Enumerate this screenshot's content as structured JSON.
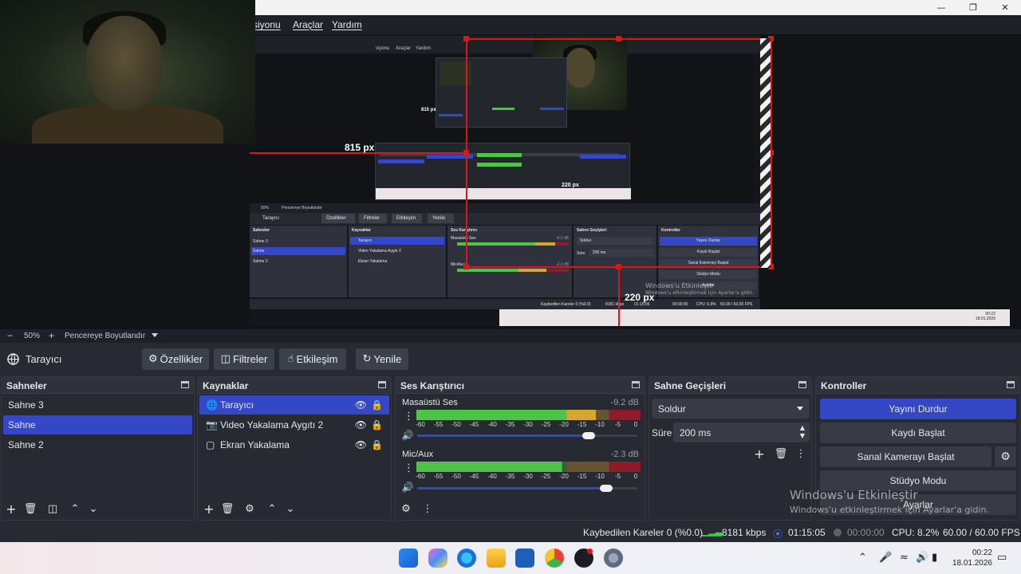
{
  "window": {
    "controls": [
      "minimize",
      "maximize",
      "close"
    ]
  },
  "menu": {
    "items": [
      "siyonu",
      "Araçlar",
      "Yardım"
    ]
  },
  "preview": {
    "label_horizontal": "815 px",
    "label_vertical": "220 px",
    "nested_labels": {
      "horizontal": "815 px",
      "vertical": "220 px"
    },
    "nested_menu": [
      "siyonu",
      "Araçlar",
      "Yardım"
    ],
    "mini_toolbar": {
      "source": "Tarayıcı",
      "buttons": [
        "Özellikler",
        "Filtreler",
        "Etkileşim",
        "Yenile"
      ]
    },
    "mini_docks": {
      "scenes_title": "Sahneler",
      "scenes": [
        "Sahne 3",
        "Sahne",
        "Sahne 2"
      ],
      "sources_title": "Kaynaklar",
      "sources": [
        "Tarayıcı",
        "Video Yakalama Aygıtı 2",
        "Ekran Yakalama"
      ],
      "mixer_title": "Ses Karıştırıcı",
      "mixer_a": "Masaüstü Ses",
      "mixer_a_db": "-9.2 dB",
      "mixer_b": "Mic/Aux",
      "mixer_b_db": "-2.3 dB",
      "trans_title": "Sahne Geçişleri",
      "trans_value": "Soldur",
      "trans_dur_label": "Süre",
      "trans_dur": "200 ms",
      "ctrl_title": "Kontroller",
      "ctrl": [
        "Yayını Durdur",
        "Kaydı Başlat",
        "Sanal Kamerayı Başlat",
        "Stüdyo Modu",
        "Ayarlar"
      ]
    },
    "mini_zoom": "50%",
    "mini_resize": "Pencereye Boyutlandır",
    "mini_status": {
      "dropped": "Kaybedilen Kareler 0 (%0.0)",
      "kbps": "8181 kbps",
      "live": "01:15:05",
      "rec": "00:00:00",
      "cpu": "CPU: 6.9%",
      "fps": "60.00 / 60.00 FPS"
    },
    "mini_watermark": [
      "Windows'u Etkinleştir",
      "Windows'u etkinleştirmek için Ayarlar'a gidin."
    ],
    "mini_clock": [
      "00:22",
      "18.01.2026"
    ]
  },
  "zoombar": {
    "minus": "−",
    "zoom": "50%",
    "plus": "+",
    "resize_label": "Pencereye Boyutlandır"
  },
  "toolbar": {
    "source_name": "Tarayıcı",
    "properties": "Özellikler",
    "filters": "Filtreler",
    "interact": "Etkileşim",
    "refresh": "Yenile"
  },
  "scenes": {
    "title": "Sahneler",
    "items": [
      "Sahne 3",
      "Sahne",
      "Sahne 2"
    ],
    "selected": "Sahne"
  },
  "sources": {
    "title": "Kaynaklar",
    "items": [
      "Tarayıcı",
      "Video Yakalama Aygıtı 2",
      "Ekran Yakalama"
    ],
    "selected": "Tarayıcı"
  },
  "mixer": {
    "title": "Ses Karıştırıcı",
    "tracks": [
      {
        "name": "Masaüstü Ses",
        "db": "-9.2 dB",
        "volume": 0.78,
        "level": 0.8
      },
      {
        "name": "Mic/Aux",
        "db": "-2.3 dB",
        "volume": 0.86,
        "level": 0.65
      }
    ],
    "scale": [
      "-60",
      "-55",
      "-50",
      "-45",
      "-40",
      "-35",
      "-30",
      "-25",
      "-20",
      "-15",
      "-10",
      "-5",
      "0"
    ]
  },
  "transitions": {
    "title": "Sahne Geçişleri",
    "type": "Soldur",
    "duration_label": "Süre",
    "duration": "200 ms"
  },
  "controls": {
    "title": "Kontroller",
    "stop_stream": "Yayını Durdur",
    "start_record": "Kaydı Başlat",
    "start_vcam": "Sanal Kamerayı Başlat",
    "studio_mode": "Stüdyo Modu",
    "settings": "Ayarlar"
  },
  "watermark": {
    "title": "Windows'u Etkinleştir",
    "subtitle": "Windows'u etkinleştirmek için Ayarlar'a gidin."
  },
  "status": {
    "dropped": "Kaybedilen Kareler 0 (%0.0)",
    "kbps": "8181 kbps",
    "live_time": "01:15:05",
    "rec_time": "00:00:00",
    "cpu": "CPU: 8.2%",
    "fps": "60.00 / 60.00 FPS"
  },
  "taskbar": {
    "time": "00:22",
    "date": "18.01.2026"
  },
  "colors": {
    "accent": "#3447c4",
    "panel": "#272a33",
    "guide_red": "#e0151b",
    "meter_green": "#4fc24a",
    "meter_yellow": "#d8a530",
    "meter_red": "#8c1c2a"
  }
}
